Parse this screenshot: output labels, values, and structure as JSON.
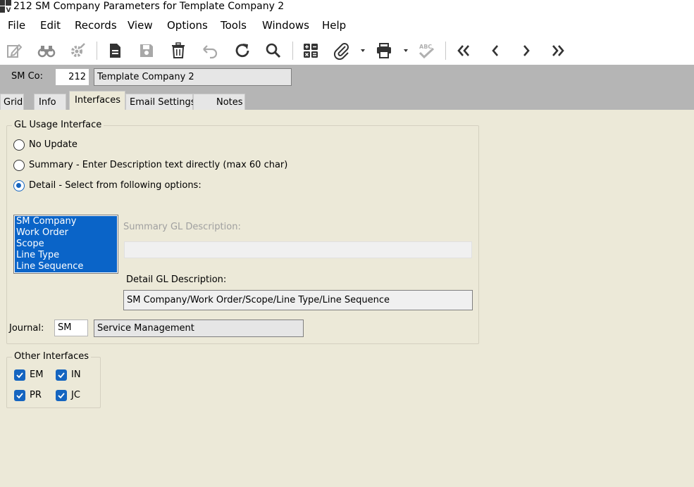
{
  "window": {
    "title": "212 SM Company Parameters for Template Company 2"
  },
  "menu": {
    "items": [
      "File",
      "Edit",
      "Records",
      "View",
      "Options",
      "Tools",
      "Windows",
      "Help"
    ]
  },
  "toolbar": {
    "icons": [
      "edit-icon",
      "binoculars-icon",
      "settings-icon",
      "new-document-icon",
      "save-icon",
      "delete-icon",
      "undo-icon",
      "refresh-icon",
      "search-icon",
      "calculator-icon",
      "attachment-icon",
      "print-icon",
      "spell-check-icon",
      "first-record-icon",
      "previous-record-icon",
      "next-record-icon",
      "last-record-icon"
    ]
  },
  "header": {
    "smco_label": "SM Co:",
    "smco_value": "212",
    "smco_description": "Template Company 2"
  },
  "tabs": [
    {
      "label": "Grid",
      "active": false
    },
    {
      "label": "Info",
      "active": false
    },
    {
      "label": "Interfaces",
      "active": true
    },
    {
      "label": "Email Settings",
      "active": false
    },
    {
      "label": "Notes",
      "active": false
    }
  ],
  "gl_usage": {
    "title": "GL Usage Interface",
    "options": [
      {
        "label": "No Update",
        "selected": false
      },
      {
        "label": "Summary - Enter Description text directly (max 60 char)",
        "selected": false
      },
      {
        "label": "Detail - Select from following options:",
        "selected": true
      }
    ],
    "list_items": [
      "SM Company",
      "Work Order",
      "Scope",
      "Line Type",
      "Line Sequence"
    ],
    "summary_label": "Summary GL Description:",
    "summary_value": "",
    "detail_label": "Detail GL Description:",
    "detail_value": "SM Company/Work Order/Scope/Line Type/Line Sequence",
    "journal_label": "Journal:",
    "journal_value": "SM",
    "journal_description": "Service Management"
  },
  "other_interfaces": {
    "title": "Other Interfaces",
    "items": [
      {
        "label": "EM",
        "checked": true
      },
      {
        "label": "IN",
        "checked": true
      },
      {
        "label": "PR",
        "checked": true
      },
      {
        "label": "JC",
        "checked": true
      }
    ]
  },
  "colors": {
    "accent": "#1565c0",
    "selection": "#0a64c8",
    "form_background": "#ece9d8",
    "header_band": "#b5b5b5"
  }
}
